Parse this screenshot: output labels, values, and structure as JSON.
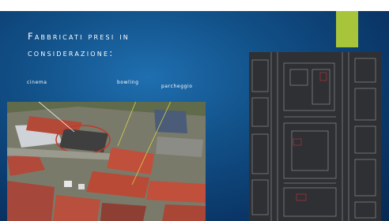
{
  "slide": {
    "title_line1": "Fabbricati presi in",
    "title_line2": "considerazione:"
  },
  "labels": {
    "cinema": "cinema",
    "bowling": "bowling",
    "parcheggio": "parcheggio"
  },
  "colors": {
    "accent": "#a8c43a",
    "background": "#114f86"
  }
}
